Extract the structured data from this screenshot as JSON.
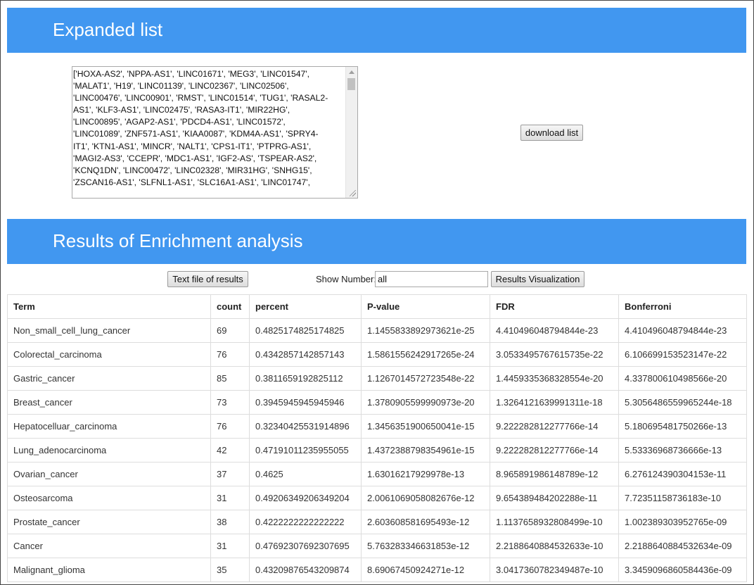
{
  "expanded": {
    "title": "Expanded list",
    "gene_lines": [
      "['HOXA-AS2', 'NPPA-AS1', 'LINC01671', 'MEG3', 'LINC01547',",
      "'MALAT1', 'H19', 'LINC01139', 'LINC02367', 'LINC02506',",
      "'LINC00476', 'LINC00901', 'RMST', 'LINC01514', 'TUG1', 'RASAL2-",
      "AS1', 'KLF3-AS1', 'LINC02475', 'RASA3-IT1', 'MIR22HG',",
      "'LINC00895', 'AGAP2-AS1', 'PDCD4-AS1', 'LINC01572',",
      "'LINC01089', 'ZNF571-AS1', 'KIAA0087', 'KDM4A-AS1', 'SPRY4-",
      "IT1', 'KTN1-AS1', 'MINCR', 'NALT1', 'CPS1-IT1', 'PTPRG-AS1',",
      "'MAGI2-AS3', 'CCEPR', 'MDC1-AS1', 'IGF2-AS', 'TSPEAR-AS2',",
      "'KCNQ1DN', 'LINC00472', 'LINC02328', 'MIR31HG', 'SNHG15',",
      "'ZSCAN16-AS1', 'SLFNL1-AS1', 'SLC16A1-AS1', 'LINC01747',"
    ],
    "download_label": "download list"
  },
  "enrichment": {
    "title": "Results of Enrichment analysis",
    "text_file_label": "Text file of results",
    "show_number_label": "Show Number:",
    "show_number_value": "all",
    "visualization_label": "Results Visualization",
    "columns": [
      "Term",
      "count",
      "percent",
      "P-value",
      "FDR",
      "Bonferroni"
    ],
    "rows": [
      [
        "Non_small_cell_lung_cancer",
        "69",
        "0.4825174825174825",
        "1.1455833892973621e-25",
        "4.410496048794844e-23",
        "4.410496048794844e-23"
      ],
      [
        "Colorectal_carcinoma",
        "76",
        "0.4342857142857143",
        "1.5861556242917265e-24",
        "3.0533495767615735e-22",
        "6.106699153523147e-22"
      ],
      [
        "Gastric_cancer",
        "85",
        "0.3811659192825112",
        "1.1267014572723548e-22",
        "1.4459335368328554e-20",
        "4.337800610498566e-20"
      ],
      [
        "Breast_cancer",
        "73",
        "0.3945945945945946",
        "1.3780905599990973e-20",
        "1.3264121639991311e-18",
        "5.3056486559965244e-18"
      ],
      [
        "Hepatocelluar_carcinoma",
        "76",
        "0.32340425531914896",
        "1.3456351900650041e-15",
        "9.222282812277766e-14",
        "5.180695481750266e-13"
      ],
      [
        "Lung_adenocarcinoma",
        "42",
        "0.47191011235955055",
        "1.4372388798354961e-15",
        "9.222282812277766e-14",
        "5.53336968736666e-13"
      ],
      [
        "Ovarian_cancer",
        "37",
        "0.4625",
        "1.63016217929978e-13",
        "8.965891986148789e-12",
        "6.276124390304153e-11"
      ],
      [
        "Osteosarcoma",
        "31",
        "0.49206349206349204",
        "2.0061069058082676e-12",
        "9.654389484202288e-11",
        "7.72351158736183e-10"
      ],
      [
        "Prostate_cancer",
        "38",
        "0.4222222222222222",
        "2.603608581695493e-12",
        "1.1137658932808499e-10",
        "1.002389303952765e-09"
      ],
      [
        "Cancer",
        "31",
        "0.47692307692307695",
        "5.763283346631853e-12",
        "2.2188640884532633e-10",
        "2.2188640884532634e-09"
      ],
      [
        "Malignant_glioma",
        "35",
        "0.43209876543209874",
        "8.69067450924271e-12",
        "3.0417360782349487e-10",
        "3.3459096860584436e-09"
      ]
    ]
  }
}
